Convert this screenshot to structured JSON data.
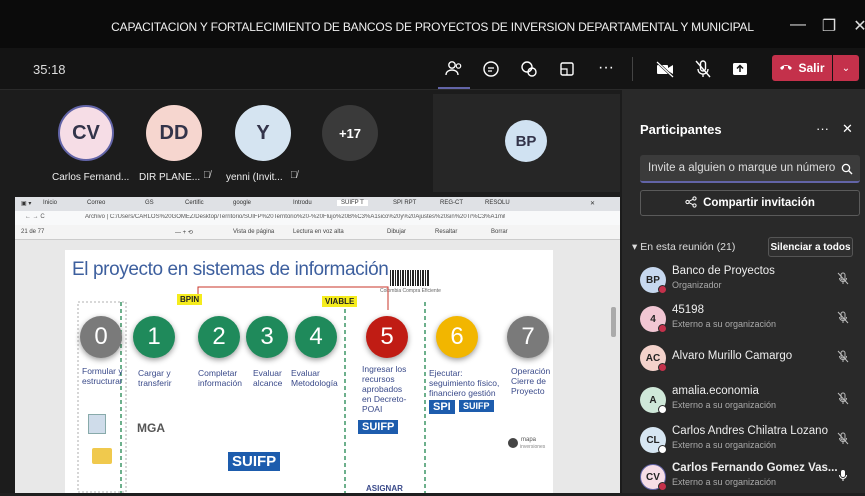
{
  "window": {
    "title": "CAPACITACION Y FORTALECIMIENTO DE BANCOS DE PROYECTOS DE INVERSION DEPARTAMENTAL Y MUNICIPAL"
  },
  "toolbar": {
    "timer": "35:18",
    "leave_label": "Salir",
    "more": "···"
  },
  "stage": {
    "avatars": [
      {
        "initials": "CV",
        "name": "Carlos Fernand...",
        "color": "#f6dde6"
      },
      {
        "initials": "DD",
        "name": "DIR PLANE...",
        "color": "#f6d6cf"
      },
      {
        "initials": "Y",
        "name": "yenni (Invit...",
        "color": "#d5e4f1"
      },
      {
        "initials": "+17",
        "name": "",
        "color": "#3a3a3a"
      },
      {
        "initials": "BP",
        "name": "",
        "color": "#d0e2f2"
      }
    ]
  },
  "shared": {
    "tabs": [
      "Inicio",
      "Correo",
      "GS",
      "Certific",
      "google",
      "Introdu",
      "SUIFP T",
      "SPI RPT",
      "REG-CT",
      "RESOLU"
    ],
    "address": "Archivo | C:/Users/CARLOS%20GOMEZ/Desktop/Territorio/SUIFP%20Territorio%20-%20Flujo%20B%C3%A1sico%20y%20Ajustes%20sin%20Tr%C3%A1mites.pdf",
    "pdf_left": "21 de 77",
    "pdf_tools": [
      "Vista de página",
      "Lectura en voz alta",
      "Dibujar",
      "Resaltar",
      "Borrar"
    ],
    "slide_title": "El proyecto en sistemas de información",
    "barcode_caption": "Colombia Compra Eficiente",
    "tag_bpin": "BPIN",
    "tag_viable": "VIABLE",
    "steps": [
      {
        "n": "0",
        "label": "Formular y\nestructurar",
        "color": "#7a7a7a"
      },
      {
        "n": "1",
        "label": "Cargar y\ntransferir",
        "color": "#1f8a5b"
      },
      {
        "n": "2",
        "label": "Completar\ninformación",
        "color": "#1f8a5b"
      },
      {
        "n": "3",
        "label": "Evaluar\nalcance",
        "color": "#1f8a5b"
      },
      {
        "n": "4",
        "label": "Evaluar\nMetodología",
        "color": "#1f8a5b"
      },
      {
        "n": "5",
        "label": "Ingresar los\nrecursos\naprobados\nen Decreto-\nPOAI",
        "color": "#c01c14"
      },
      {
        "n": "6",
        "label": "Ejecutar:\nseguimiento físico,\nfinanciero gestión",
        "color": "#f2b600"
      },
      {
        "n": "7",
        "label": "Operación\nCierre de\nProyecto",
        "color": "#7a7a7a"
      }
    ],
    "logos": {
      "mga": "MGA",
      "suifp": "SUIFP",
      "suifp_small": "SUIFP",
      "spi": "SPI",
      "suifp2": "SUIFP",
      "mapa": "mapa",
      "mapa_sub": "inversiones",
      "asignar": "ASIGNAR"
    }
  },
  "panel": {
    "title": "Participantes",
    "search_placeholder": "Invite a alguien o marque un número",
    "share_label": "Compartir invitación",
    "in_meeting": "En esta reunión (21)",
    "mute_all": "Silenciar a todos",
    "participants": [
      {
        "initials": "BP",
        "name": "Banco de Proyectos",
        "sub": "Organizador",
        "color": "#c6d8ef"
      },
      {
        "initials": "4",
        "name": "45198",
        "sub": "Externo a su organización",
        "color": "#f1c6d3"
      },
      {
        "initials": "AC",
        "name": "Alvaro Murillo Camargo",
        "sub": "",
        "color": "#f3d2cb"
      },
      {
        "initials": "A",
        "name": "amalia.economia",
        "sub": "Externo a su organización",
        "color": "#cfe8d9"
      },
      {
        "initials": "CL",
        "name": "Carlos Andres Chilatra Lozano",
        "sub": "Externo a su organización",
        "color": "#d6e6f2"
      },
      {
        "initials": "CV",
        "name": "Carlos Fernando Gomez Vas...",
        "sub": "Externo a su organización",
        "color": "#f6dde6"
      }
    ]
  }
}
